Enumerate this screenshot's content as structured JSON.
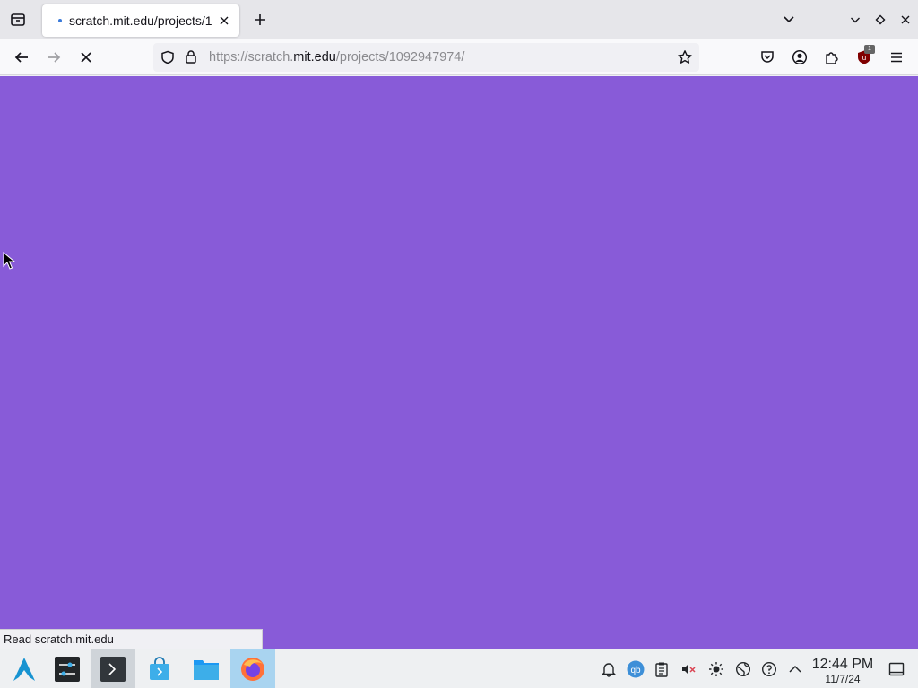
{
  "tabs": [
    {
      "title": "scratch.mit.edu/projects/1",
      "loading": true
    }
  ],
  "urlbar": {
    "prefix": "https://scratch.",
    "host": "mit.edu",
    "path": "/projects/1092947974/"
  },
  "toolbar": {
    "extension_badge": "1"
  },
  "page": {
    "background": "#885bd8"
  },
  "status": {
    "text": "Read scratch.mit.edu"
  },
  "taskbar": {
    "clock_time": "12:44 PM",
    "clock_date": "11/7/24"
  },
  "colors": {
    "accent": "#3a7ad9",
    "ublock": "#800000"
  }
}
